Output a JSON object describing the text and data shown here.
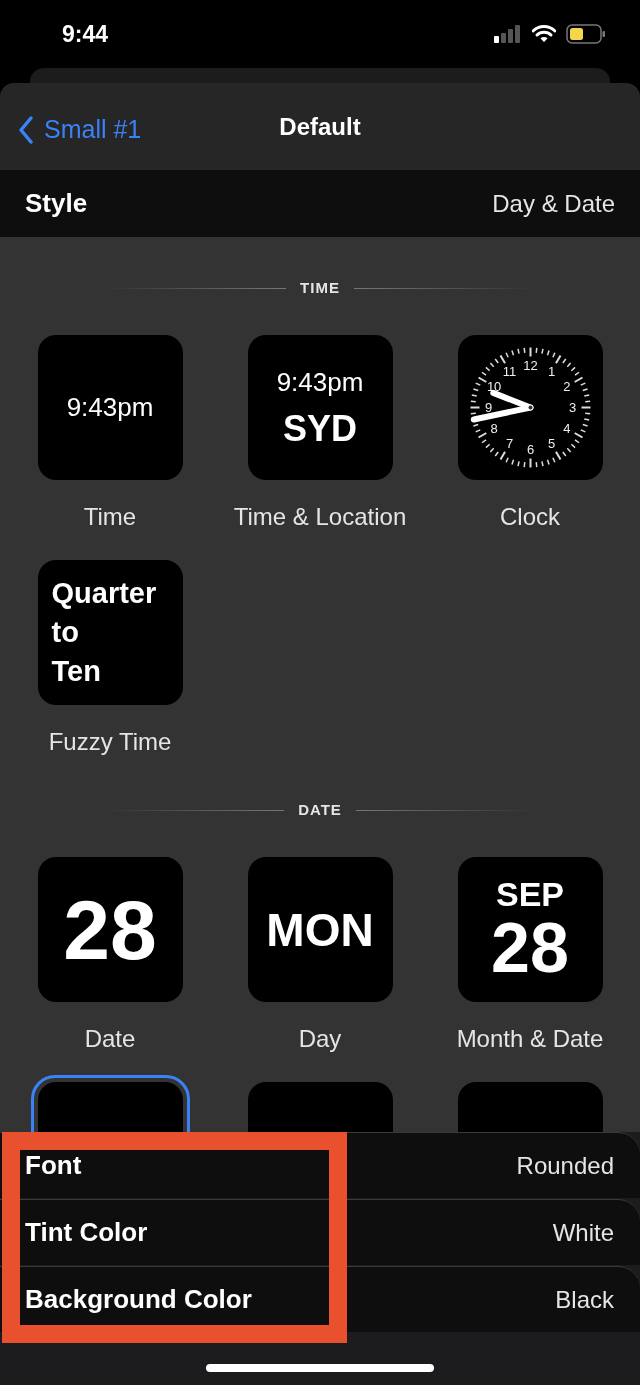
{
  "status_bar": {
    "time": "9:44"
  },
  "nav": {
    "back_label": "Small #1",
    "title": "Default"
  },
  "style_row": {
    "label": "Style",
    "value": "Day & Date"
  },
  "sections": [
    {
      "title": "TIME",
      "tiles": [
        {
          "kind": "text",
          "lines": [
            "9:43pm"
          ],
          "label": "Time",
          "selected": false
        },
        {
          "kind": "text_two",
          "lines": [
            "9:43pm",
            "SYD"
          ],
          "label": "Time & Location",
          "selected": false
        },
        {
          "kind": "clock",
          "dial_numbers": [
            "11",
            "12",
            "1",
            "10",
            "2",
            "9",
            "3",
            "8",
            "4",
            "7",
            "6",
            "5"
          ],
          "label": "Clock",
          "selected": false
        },
        {
          "kind": "fuzzy",
          "lines": [
            "Quarter",
            "to",
            "Ten"
          ],
          "label": "Fuzzy Time",
          "selected": false
        }
      ]
    },
    {
      "title": "DATE",
      "tiles": [
        {
          "kind": "big",
          "lines": [
            "28"
          ],
          "label": "Date",
          "selected": false
        },
        {
          "kind": "medium",
          "lines": [
            "MON"
          ],
          "label": "Day",
          "selected": false
        },
        {
          "kind": "month",
          "lines": [
            "SEP",
            "28"
          ],
          "label": "Month & Date",
          "selected": false
        },
        {
          "kind": "covered",
          "selected": true
        },
        {
          "kind": "covered",
          "selected": false
        },
        {
          "kind": "covered",
          "selected": false
        }
      ]
    }
  ],
  "settings": [
    {
      "label": "Font",
      "value": "Rounded"
    },
    {
      "label": "Tint Color",
      "value": "White"
    },
    {
      "label": "Background Color",
      "value": "Black"
    }
  ]
}
